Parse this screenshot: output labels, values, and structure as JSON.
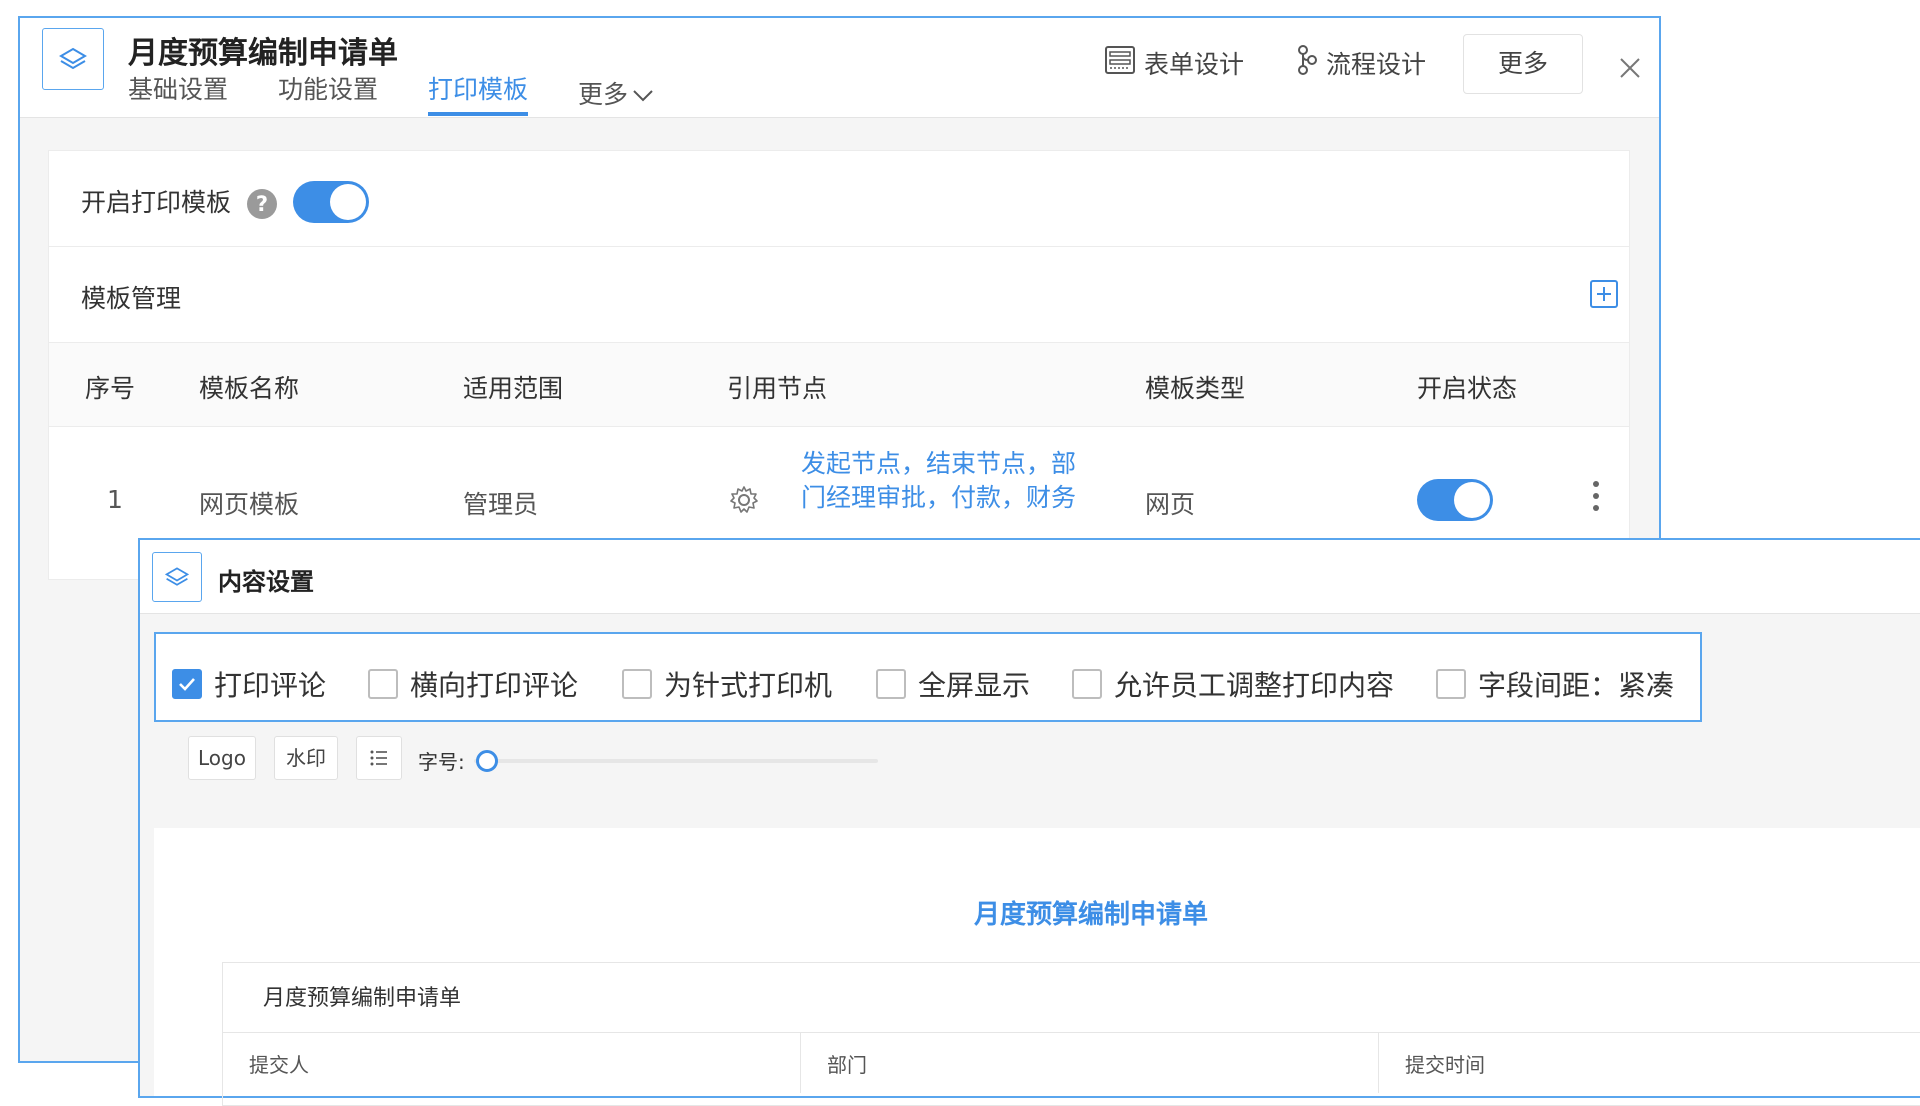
{
  "window": {
    "title": "月度预算编制申请单",
    "tabs": [
      {
        "label": "基础设置",
        "active": false
      },
      {
        "label": "功能设置",
        "active": false
      },
      {
        "label": "打印模板",
        "active": true
      },
      {
        "label": "更多",
        "active": false
      }
    ],
    "toolbar": {
      "form_design": "表单设计",
      "flow_design": "流程设计",
      "more": "更多"
    }
  },
  "print_settings": {
    "enable_label": "开启打印模板",
    "enabled": true,
    "help_symbol": "?"
  },
  "template_management": {
    "title": "模板管理",
    "columns": [
      "序号",
      "模板名称",
      "适用范围",
      "引用节点",
      "模板类型",
      "开启状态"
    ],
    "rows": [
      {
        "index": "1",
        "name": "网页模板",
        "scope": "管理员",
        "nodes": "发起节点，结束节点，部门经理审批，付款，财务",
        "type": "网页",
        "enabled": true
      }
    ]
  },
  "content_settings": {
    "title": "内容设置",
    "options": [
      {
        "label": "打印评论",
        "checked": true
      },
      {
        "label": "横向打印评论",
        "checked": false
      },
      {
        "label": "为针式打印机",
        "checked": false
      },
      {
        "label": "全屏显示",
        "checked": false
      },
      {
        "label": "允许员工调整打印内容",
        "checked": false
      },
      {
        "label": "字段间距：紧凑",
        "checked": false
      }
    ],
    "tools": {
      "logo": "Logo",
      "watermark": "水印",
      "font_size_label": "字号:",
      "font_size_level": 0
    }
  },
  "preview": {
    "title": "月度预算编制申请单",
    "section_title": "月度预算编制申请单",
    "fields": [
      "提交人",
      "部门",
      "提交时间"
    ]
  },
  "colors": {
    "accent": "#3d8ee6",
    "border_accent": "#5aa6ee"
  }
}
